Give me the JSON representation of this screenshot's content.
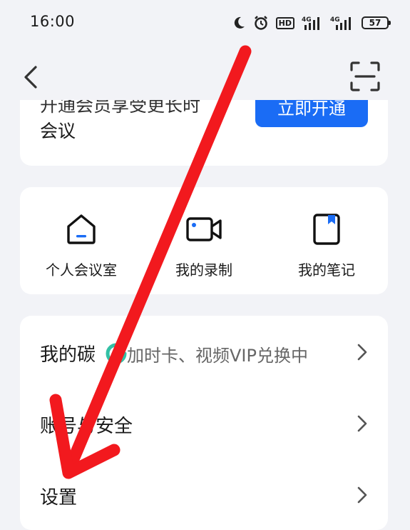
{
  "status_bar": {
    "time": "16:00",
    "hd_label": "HD",
    "signal1_label": "4G",
    "signal2_label": "4G",
    "battery_level": "57"
  },
  "promo": {
    "text_cut": "开通会员享受更长时",
    "text": "会议",
    "button_label": "立即开通"
  },
  "quick_actions": [
    {
      "label": "个人会议室",
      "icon": "home-icon"
    },
    {
      "label": "我的录制",
      "icon": "video-camera-icon"
    },
    {
      "label": "我的笔记",
      "icon": "notebook-icon"
    }
  ],
  "settings_list": [
    {
      "label": "我的碳",
      "sub": "加时卡、视频VIP兑换中"
    },
    {
      "label": "账号与安全",
      "sub": ""
    },
    {
      "label": "设置",
      "sub": ""
    }
  ],
  "colors": {
    "accent": "#1a6cf5",
    "annotation_arrow": "#f2191e",
    "background": "#f2f3f7"
  }
}
